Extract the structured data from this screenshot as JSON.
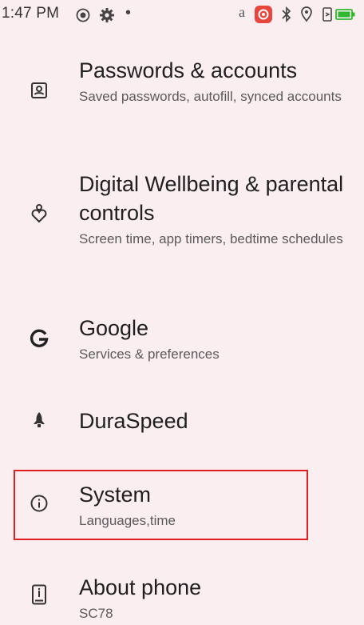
{
  "status_bar": {
    "time": "1:47 PM",
    "dot": "•",
    "letter": "a",
    "icons": [
      "screen-record-icon",
      "gear-icon",
      "app-notification-icon",
      "bluetooth-icon",
      "location-icon",
      "vibrate-icon",
      "battery-icon"
    ],
    "accent_color": "#e8453c",
    "battery_color": "#2eb82e"
  },
  "settings": [
    {
      "key": "passwords",
      "title": "Passwords & accounts",
      "subtitle": "Saved passwords, autofill, synced accounts",
      "icon": "account-box-icon"
    },
    {
      "key": "wellbeing",
      "title": "Digital Wellbeing & parental controls",
      "subtitle": "Screen time, app timers, bedtime schedules",
      "icon": "wellbeing-icon"
    },
    {
      "key": "google",
      "title": "Google",
      "subtitle": "Services & preferences",
      "icon": "google-icon"
    },
    {
      "key": "duraspeed",
      "title": "DuraSpeed",
      "subtitle": "",
      "icon": "rocket-icon"
    },
    {
      "key": "system",
      "title": "System",
      "subtitle": "Languages,time",
      "icon": "info-icon"
    },
    {
      "key": "about",
      "title": "About phone",
      "subtitle": "SC78",
      "icon": "phone-icon"
    }
  ],
  "highlight_color": "#e0201e"
}
